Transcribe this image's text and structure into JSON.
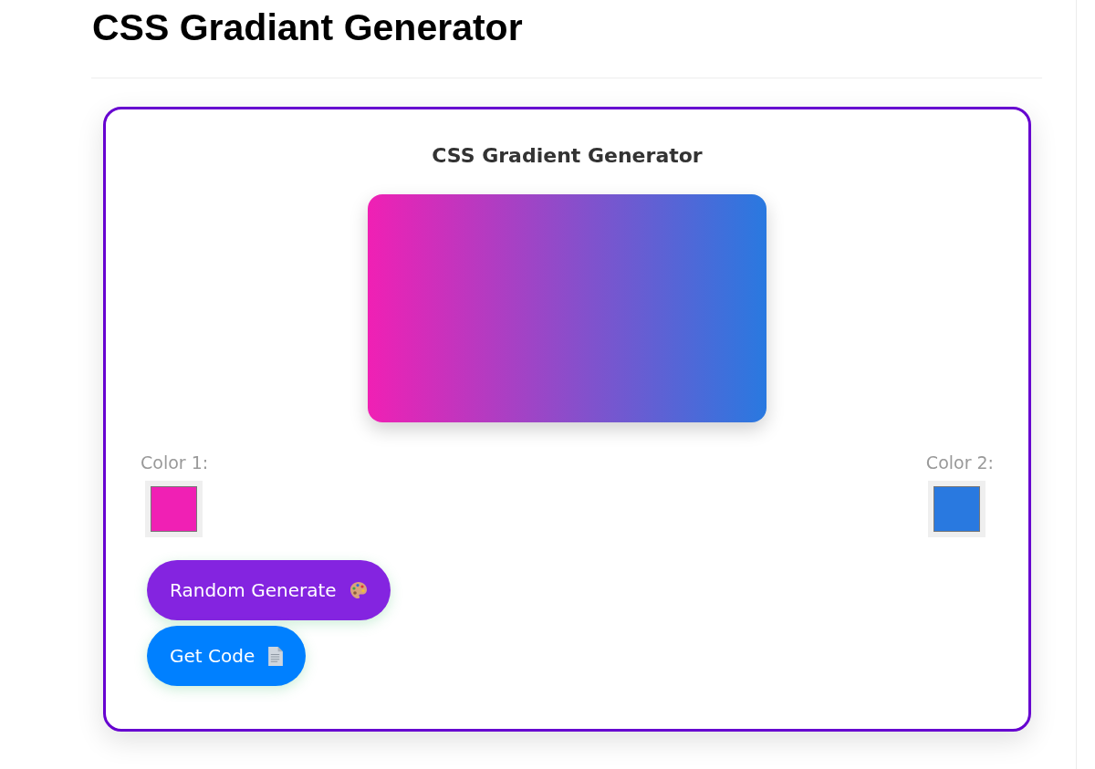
{
  "page": {
    "title": "CSS Gradiant Generator"
  },
  "generator": {
    "title": "CSS Gradient Generator",
    "colors": [
      {
        "label": "Color 1:",
        "color": "#f020b4"
      },
      {
        "label": "Color 2:",
        "color": "#2979e0"
      }
    ],
    "buttons": [
      {
        "label": "Random Generate",
        "kind": "random"
      },
      {
        "label": "Get Code",
        "kind": "code"
      }
    ]
  }
}
